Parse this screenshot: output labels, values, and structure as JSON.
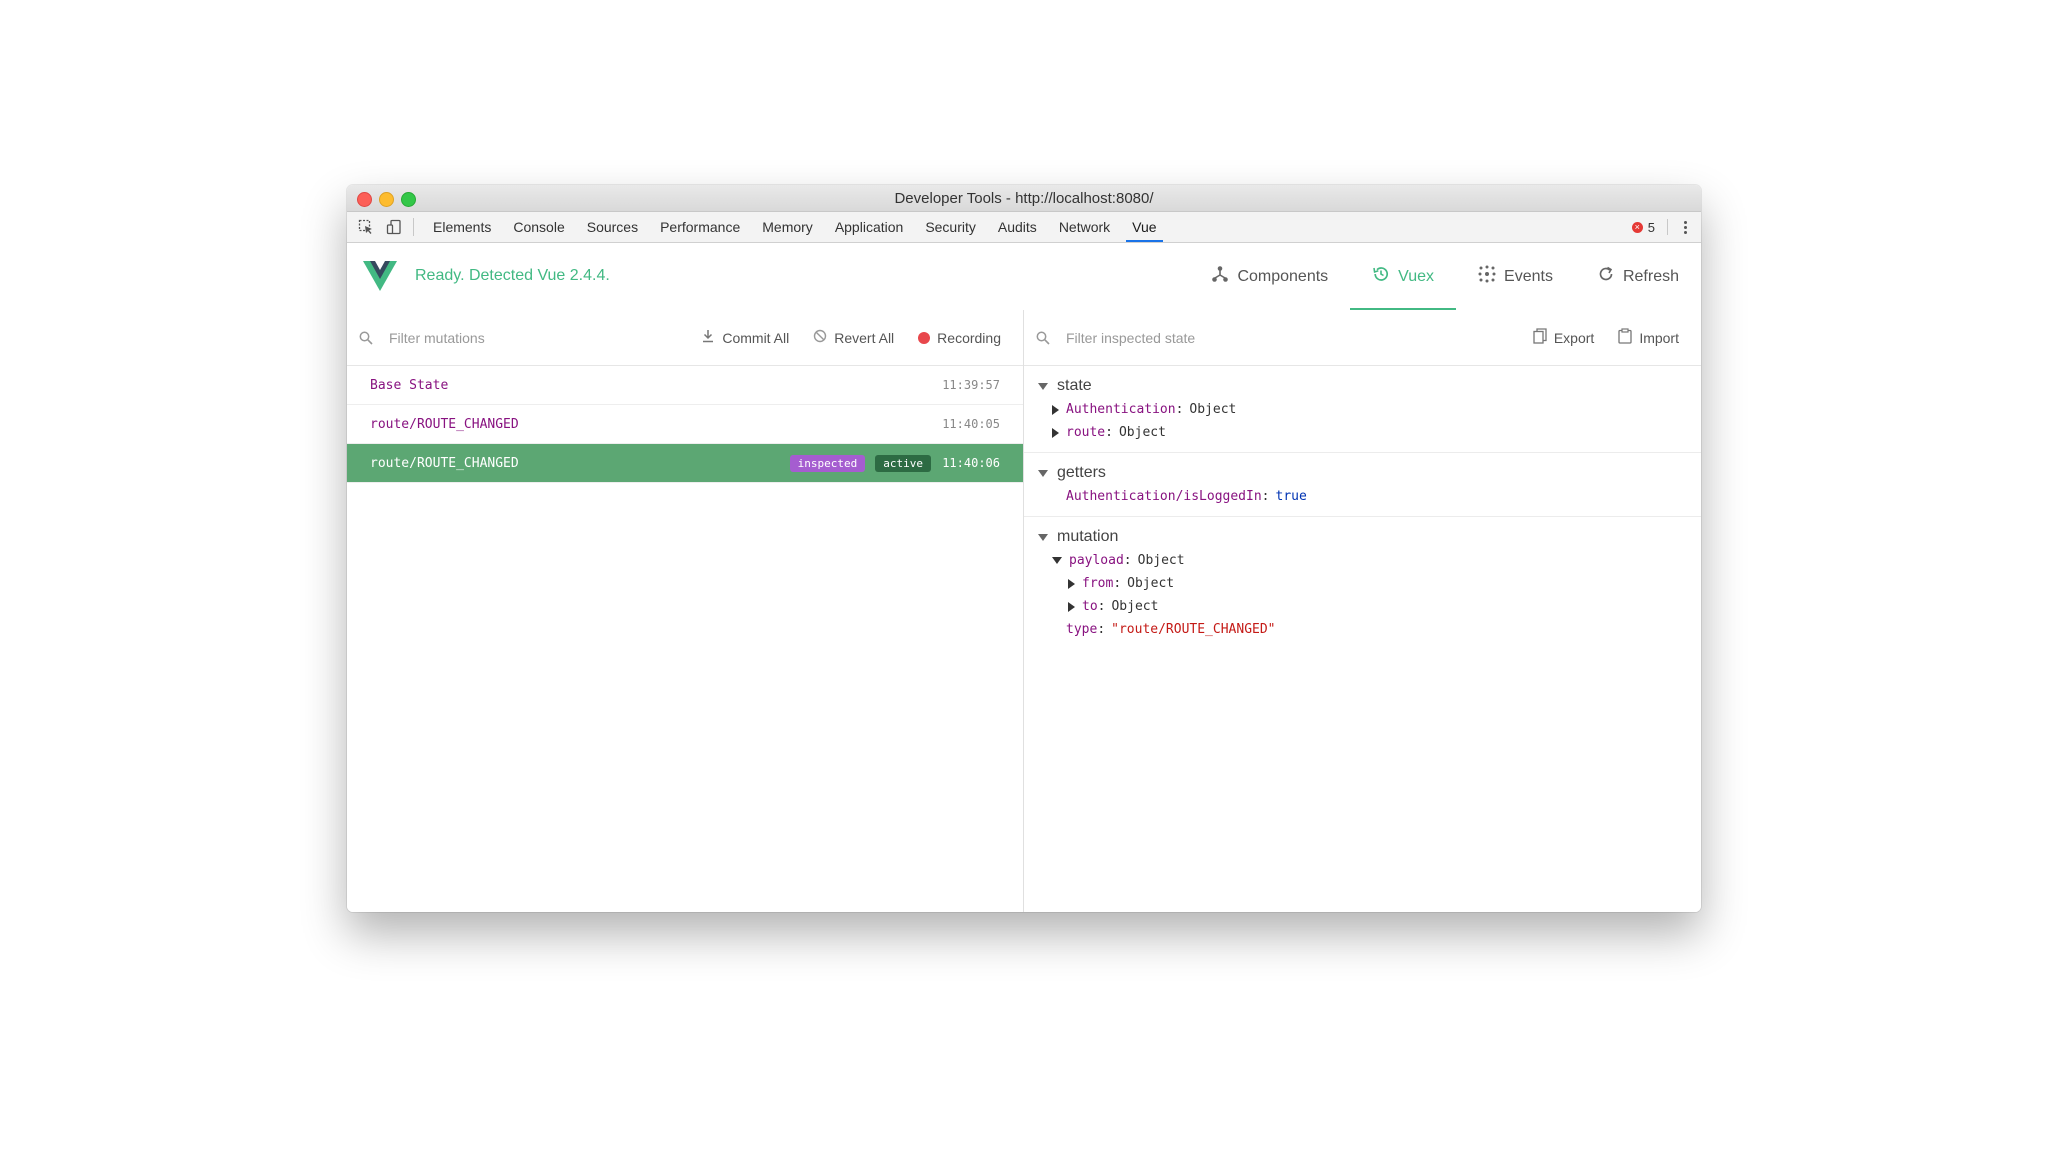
{
  "window": {
    "title": "Developer Tools - http://localhost:8080/"
  },
  "devtools": {
    "tabs": [
      "Elements",
      "Console",
      "Sources",
      "Performance",
      "Memory",
      "Application",
      "Security",
      "Audits",
      "Network",
      "Vue"
    ],
    "active_tab": "Vue",
    "error_count": "5"
  },
  "vue": {
    "status": "Ready. Detected Vue 2.4.4.",
    "nav": [
      {
        "label": "Components",
        "icon": "components-icon"
      },
      {
        "label": "Vuex",
        "icon": "history-icon"
      },
      {
        "label": "Events",
        "icon": "events-icon"
      },
      {
        "label": "Refresh",
        "icon": "refresh-icon"
      }
    ],
    "active_nav": "Vuex",
    "accent": "#42b983"
  },
  "mutations_pane": {
    "filter_placeholder": "Filter mutations",
    "commit_all": "Commit All",
    "revert_all": "Revert All",
    "recording": "Recording",
    "rows": [
      {
        "name": "Base State",
        "time": "11:39:57"
      },
      {
        "name": "route/ROUTE_CHANGED",
        "time": "11:40:05"
      },
      {
        "name": "route/ROUTE_CHANGED",
        "time": "11:40:06",
        "badge_inspected": "inspected",
        "badge_active": "active"
      }
    ]
  },
  "state_pane": {
    "filter_placeholder": "Filter inspected state",
    "export": "Export",
    "import": "Import",
    "state": {
      "title": "state",
      "items": [
        {
          "key": "Authentication",
          "value": "Object"
        },
        {
          "key": "route",
          "value": "Object"
        }
      ]
    },
    "getters": {
      "title": "getters",
      "items": [
        {
          "key": "Authentication/isLoggedIn",
          "value": "true"
        }
      ]
    },
    "mutation": {
      "title": "mutation",
      "payload_key": "payload",
      "payload_value": "Object",
      "children": [
        {
          "key": "from",
          "value": "Object"
        },
        {
          "key": "to",
          "value": "Object"
        }
      ],
      "type_key": "type",
      "type_value": "\"route/ROUTE_CHANGED\""
    }
  }
}
